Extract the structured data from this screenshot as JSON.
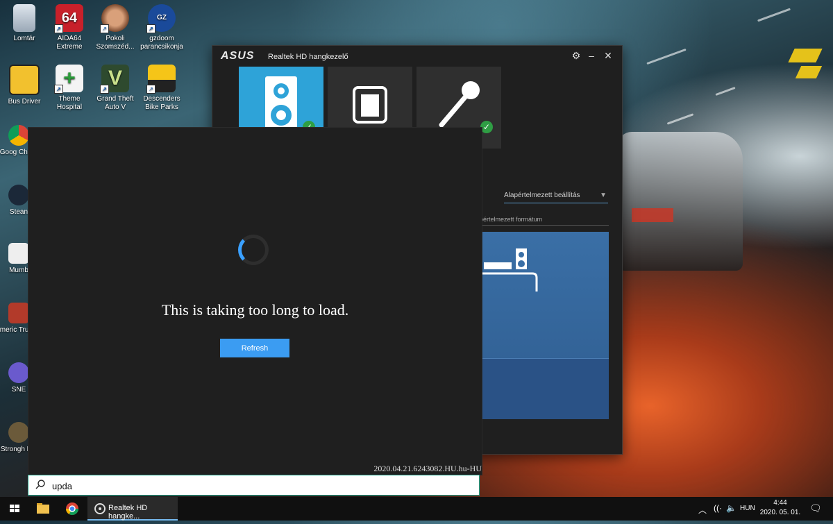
{
  "desktop": {
    "icons": [
      {
        "label": "Lomtár"
      },
      {
        "label": "AIDA64 Extreme"
      },
      {
        "label": "Pokoli Szomszéd..."
      },
      {
        "label": "gzdoom parancsikonja"
      },
      {
        "label": "Bus Driver"
      },
      {
        "label": "Theme Hospital"
      },
      {
        "label": "Grand Theft Auto V"
      },
      {
        "label": "Descenders Bike Parks"
      },
      {
        "label": "Goog Chron"
      },
      {
        "label": "Stean"
      },
      {
        "label": "Mumb"
      },
      {
        "label": "Americ Truck S"
      },
      {
        "label": "SNE"
      },
      {
        "label": "Strongh HD"
      }
    ]
  },
  "realtek": {
    "brand": "ASUS",
    "title": "Realtek HD hangkezelő",
    "dropdown_value": "Alapértelmezett beállítás",
    "format_label": "pértelmezett formátum"
  },
  "flyout": {
    "message": "This is taking too long to load.",
    "refresh_label": "Refresh",
    "version": "2020.04.21.6243082.HU.hu-HU"
  },
  "search": {
    "query": "upda"
  },
  "taskbar": {
    "app_label": "Realtek HD hangke...",
    "language": "HUN",
    "time": "4:44",
    "date": "2020. 05. 01."
  }
}
